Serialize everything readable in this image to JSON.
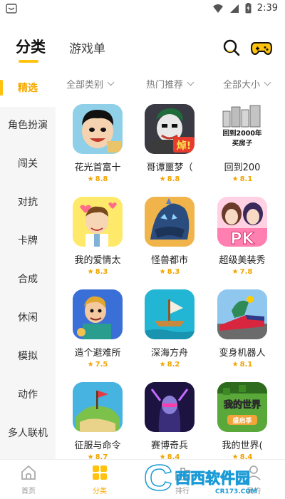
{
  "status_bar": {
    "time": "2:39"
  },
  "header": {
    "tab_active": "分类",
    "tab_other": "游戏单",
    "icons": [
      "search-icon",
      "gamepad-icon"
    ]
  },
  "sidebar": {
    "items": [
      {
        "label": "精选",
        "active": true
      },
      {
        "label": "角色扮演"
      },
      {
        "label": "闯关"
      },
      {
        "label": "对抗"
      },
      {
        "label": "卡牌"
      },
      {
        "label": "合成"
      },
      {
        "label": "休闲"
      },
      {
        "label": "模拟"
      },
      {
        "label": "动作"
      },
      {
        "label": "多人联机"
      }
    ]
  },
  "filters": [
    {
      "label": "全部类别"
    },
    {
      "label": "热门推荐"
    },
    {
      "label": "全部大小"
    }
  ],
  "games": [
    {
      "name": "花光首富十",
      "rating": "8.8",
      "icon": "cartoon-rich-man-icon"
    },
    {
      "name": "哥谭噩梦（",
      "rating": "8.8",
      "icon": "joker-icon",
      "art_text": "焯!"
    },
    {
      "name": "回到200",
      "rating": "8.1",
      "icon": "buildings-icon",
      "art_text": "回到2000年",
      "art_text2": "买房子"
    },
    {
      "name": "我的爱情太",
      "rating": "8.3",
      "icon": "love-cartoon-icon"
    },
    {
      "name": "怪兽都市",
      "rating": "8.3",
      "icon": "monster-icon"
    },
    {
      "name": "超级美装秀",
      "rating": "7.8",
      "icon": "pk-girls-icon",
      "art_text": "PK"
    },
    {
      "name": "造个避难所",
      "rating": "7.5",
      "icon": "shelter-man-icon"
    },
    {
      "name": "深海方舟",
      "rating": "8.2",
      "icon": "raft-icon"
    },
    {
      "name": "变身机器人",
      "rating": "8.1",
      "icon": "robot-train-icon"
    },
    {
      "name": "征服与命令",
      "rating": "8.7",
      "icon": "flag-island-icon"
    },
    {
      "name": "赛博奇兵",
      "rating": "8.4",
      "icon": "cyber-warrior-icon"
    },
    {
      "name": "我的世界(",
      "rating": "8.4",
      "icon": "minecraft-icon",
      "art_text": "我的世界",
      "art_text2": "盛启季"
    }
  ],
  "bottom_nav": [
    {
      "label": "首页",
      "icon": "home-icon"
    },
    {
      "label": "分类",
      "icon": "category-icon",
      "active": true
    },
    {
      "label": "排行",
      "icon": "rank-icon"
    },
    {
      "label": "我的",
      "icon": "profile-icon"
    }
  ],
  "watermark": {
    "brand": "西西软件园",
    "url": "CR173.COM"
  },
  "colors": {
    "accent": "#ffc20e",
    "rating": "#f0a400",
    "sidebar_bg": "#f6f6f6"
  }
}
